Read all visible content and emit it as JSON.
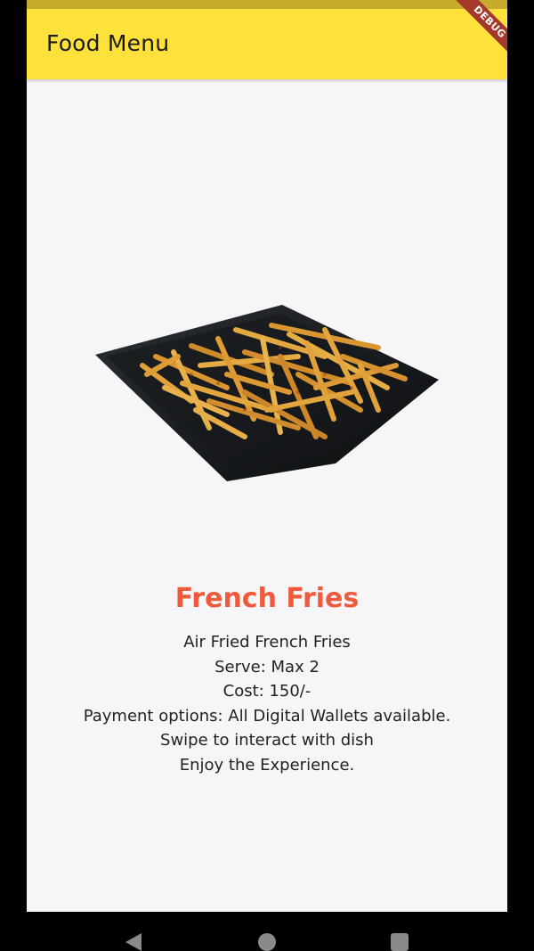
{
  "app_bar": {
    "title": "Food Menu",
    "debug_label": "DEBUG",
    "color": "#fee23b"
  },
  "dish": {
    "name": "French Fries",
    "name_color": "#ef5a3c",
    "image_icon": "french-fries-plate-image",
    "details": [
      "Air Fried French Fries",
      "Serve: Max 2",
      "Cost: 150/-",
      "Payment options: All Digital Wallets available.",
      "Swipe to interact with dish",
      "Enjoy the Experience."
    ]
  },
  "nav": {
    "back_icon": "back-triangle-icon",
    "home_icon": "home-circle-icon",
    "recent_icon": "recent-apps-square-icon"
  }
}
